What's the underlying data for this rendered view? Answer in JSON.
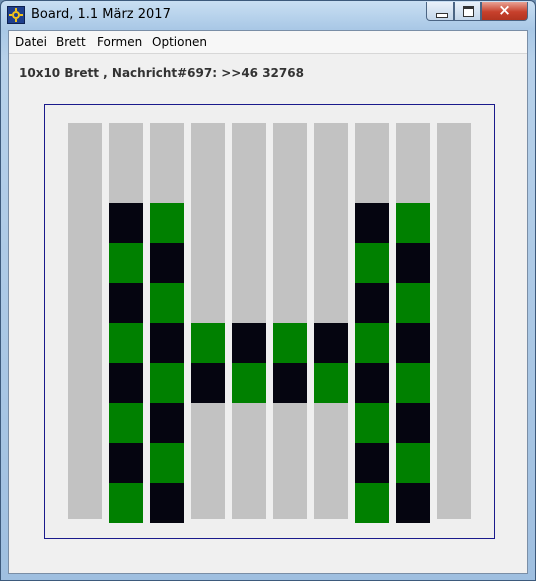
{
  "window": {
    "title": "Board, 1.1 März 2017",
    "close_label": "×"
  },
  "menu": {
    "items": [
      "Datei",
      "Brett",
      "Formen",
      "Optionen"
    ]
  },
  "status": {
    "text": "10x10 Brett , Nachricht#697: >>46 32768"
  },
  "board": {
    "columns": 10,
    "rows": 10,
    "colors": {
      "G": "#008000",
      "B": "#050510",
      "empty": "#c2c2c2"
    },
    "cells": [
      "..........",
      "..........",
      ".BG....BG.",
      ".GB....GB.",
      ".BG....BG.",
      ".GBGBGBGB.",
      ".BGBGBGBG.",
      ".GB....GB.",
      ".BG....BG.",
      ".GB....GB."
    ]
  }
}
